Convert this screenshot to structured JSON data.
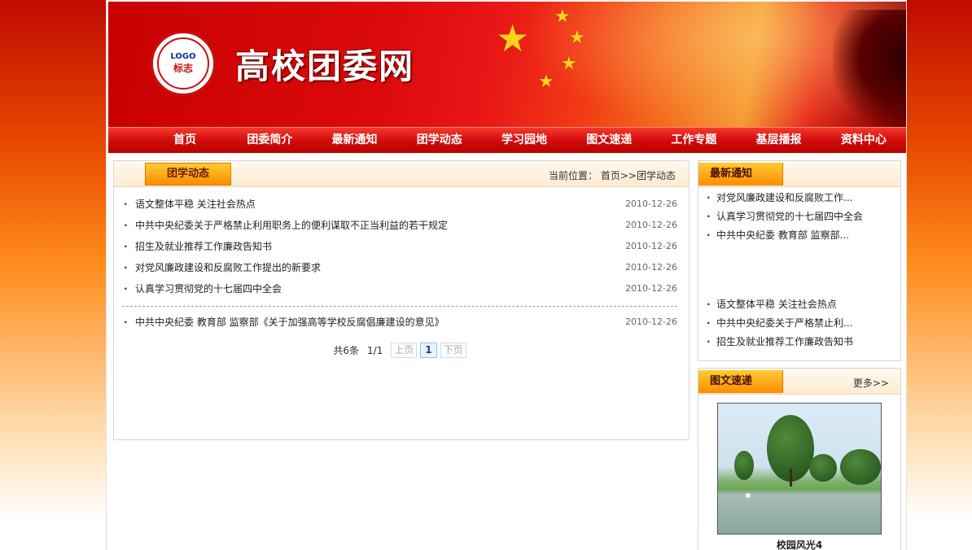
{
  "header": {
    "site_title": "高校团委网",
    "logo_word": "LOGO",
    "logo_cn": "标志"
  },
  "nav": {
    "items": [
      "首页",
      "团委简介",
      "最新通知",
      "团学动态",
      "学习园地",
      "图文速递",
      "工作专题",
      "基层播报",
      "资料中心"
    ]
  },
  "main": {
    "tab_label": "团学动态",
    "breadcrumb_prefix": "当前位置：",
    "breadcrumb_path": "首页>>团学动态",
    "articles": [
      {
        "title": "语文整体平稳 关注社会热点",
        "date": "2010-12-26"
      },
      {
        "title": "中共中央纪委关于严格禁止利用职务上的便利谋取不正当利益的若干规定",
        "date": "2010-12-26"
      },
      {
        "title": "招生及就业推荐工作廉政告知书",
        "date": "2010-12-26"
      },
      {
        "title": "对党风廉政建设和反腐败工作提出的新要求",
        "date": "2010-12-26"
      },
      {
        "title": "认真学习贯彻党的十七届四中全会",
        "date": "2010-12-26"
      }
    ],
    "articles_after_divider": [
      {
        "title": "中共中央纪委 教育部 监察部《关于加强高等学校反腐倡廉建设的意见》",
        "date": "2010-12-26"
      }
    ],
    "pager": {
      "total": "共6条",
      "pages": "1/1",
      "prev": "上页",
      "current": "1",
      "next": "下页"
    }
  },
  "sidebar": {
    "notice": {
      "title": "最新通知",
      "items_top": [
        "对党风廉政建设和反腐败工作...",
        "认真学习贯彻党的十七届四中全会",
        "中共中央纪委 教育部 监察部..."
      ],
      "items_bottom": [
        "语文整体平稳 关注社会热点",
        "中共中央纪委关于严格禁止利...",
        "招生及就业推荐工作廉政告知书"
      ]
    },
    "photos": {
      "title": "图文速递",
      "more": "更多>>",
      "caption": "校园风光4"
    }
  },
  "colors": {
    "brand_red": "#d40c0c",
    "tab_orange": "#ff8c00",
    "star_yellow": "#ffd21a"
  }
}
